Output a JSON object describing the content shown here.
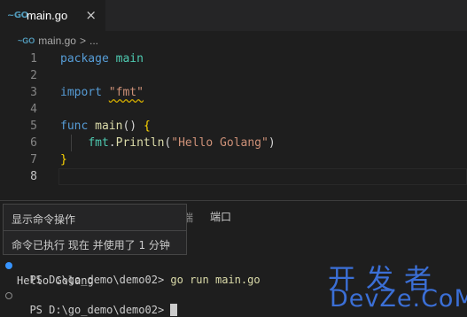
{
  "tab": {
    "icon": "go-file-icon",
    "label": "main.go",
    "close": "×"
  },
  "breadcrumb": {
    "icon": "go-file-icon",
    "file": "main.go",
    "separator": ">",
    "more": "..."
  },
  "editor": {
    "active_line": 8,
    "lines": [
      {
        "n": "1",
        "tokens": [
          [
            "kw",
            "package"
          ],
          [
            "plain",
            " "
          ],
          [
            "pkg",
            "main"
          ]
        ]
      },
      {
        "n": "2",
        "tokens": []
      },
      {
        "n": "3",
        "tokens": [
          [
            "kw",
            "import"
          ],
          [
            "plain",
            " "
          ],
          [
            "str",
            "\"fmt\""
          ]
        ]
      },
      {
        "n": "4",
        "tokens": []
      },
      {
        "n": "5",
        "tokens": [
          [
            "kw",
            "func"
          ],
          [
            "plain",
            " "
          ],
          [
            "fn",
            "main"
          ],
          [
            "plain",
            "() "
          ],
          [
            "brace",
            "{"
          ]
        ]
      },
      {
        "n": "6",
        "tokens": [
          [
            "plain",
            "    "
          ],
          [
            "pkg",
            "fmt"
          ],
          [
            "plain",
            "."
          ],
          [
            "fn",
            "Println"
          ],
          [
            "plain",
            "("
          ],
          [
            "str",
            "\"Hello Golang\""
          ],
          [
            "plain",
            ")"
          ]
        ]
      },
      {
        "n": "7",
        "tokens": [
          [
            "brace",
            "}"
          ]
        ]
      },
      {
        "n": "8",
        "tokens": []
      }
    ]
  },
  "panel": {
    "partial_tab": "端",
    "ports_tab": "端口"
  },
  "hover": {
    "title": "显示命令操作",
    "body": "命令已执行 现在 并使用了 1 分钟"
  },
  "terminal": {
    "line1_prompt": "PS D:\\go_demo\\demo02> ",
    "line1_cmd": "go run main.go",
    "line2": "Hello Golang",
    "line3_prompt": "PS D:\\go_demo\\demo02> "
  },
  "watermark": {
    "cn": "开发者",
    "en": "DevZe.CoM"
  },
  "colors": {
    "accent": "#3794ff",
    "watermark": "#3b6fd6",
    "keyword": "#569cd6",
    "string": "#ce9178"
  }
}
